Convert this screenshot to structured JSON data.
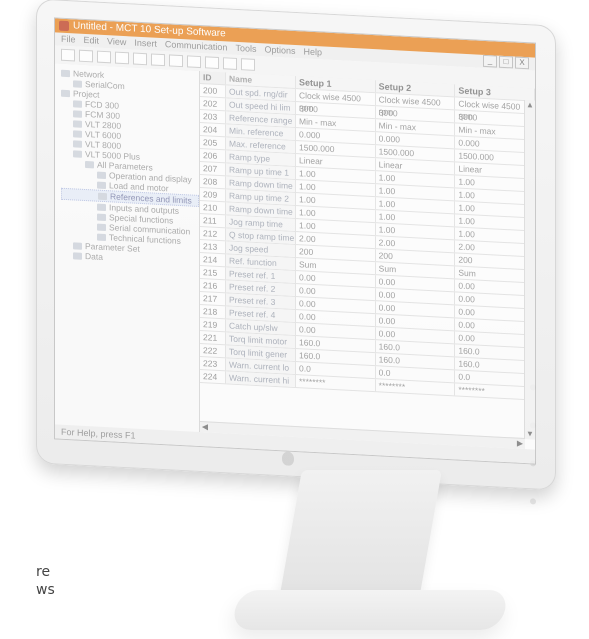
{
  "background": {
    "fragment_1": "re",
    "fragment_2": "ws"
  },
  "window": {
    "title": "Untitled - MCT 10 Set-up Software",
    "menu": [
      "File",
      "Edit",
      "View",
      "Insert",
      "Communication",
      "Tools",
      "Options",
      "Help"
    ],
    "controls": [
      "_",
      "□",
      "X"
    ],
    "status": "For Help, press F1"
  },
  "tree": {
    "items": [
      "Network",
      "SerialCom",
      "Project",
      "FCD 300",
      "FCM 300",
      "VLT 2800",
      "VLT 6000",
      "VLT 8000",
      "VLT 5000 Plus",
      "All Parameters",
      "Operation and display",
      "Load and motor",
      "References and limits",
      "Inputs and outputs",
      "Special functions",
      "Serial communication",
      "Technical functions",
      "Parameter Set",
      "Data"
    ],
    "selected_index": 12
  },
  "grid": {
    "headers": {
      "id": "ID",
      "name": "Name",
      "setup1": "Setup 1",
      "setup2": "Setup 2",
      "setup3": "Setup 3"
    },
    "rows": [
      {
        "id": "200",
        "name": "Out spd. rng/dir",
        "s1": "Clock wise 4500 rpm",
        "s2": "Clock wise 4500 rpm",
        "s3": "Clock wise 4500 rpm"
      },
      {
        "id": "202",
        "name": "Out speed hi lim",
        "s1": "3000",
        "s2": "3000",
        "s3": "3000"
      },
      {
        "id": "203",
        "name": "Reference range",
        "s1": "Min - max",
        "s2": "Min - max",
        "s3": "Min - max"
      },
      {
        "id": "204",
        "name": "Min. reference",
        "s1": "0.000",
        "s2": "0.000",
        "s3": "0.000"
      },
      {
        "id": "205",
        "name": "Max. reference",
        "s1": "1500.000",
        "s2": "1500.000",
        "s3": "1500.000"
      },
      {
        "id": "206",
        "name": "Ramp type",
        "s1": "Linear",
        "s2": "Linear",
        "s3": "Linear"
      },
      {
        "id": "207",
        "name": "Ramp up time 1",
        "s1": "1.00",
        "s2": "1.00",
        "s3": "1.00"
      },
      {
        "id": "208",
        "name": "Ramp down time 1",
        "s1": "1.00",
        "s2": "1.00",
        "s3": "1.00"
      },
      {
        "id": "209",
        "name": "Ramp up time 2",
        "s1": "1.00",
        "s2": "1.00",
        "s3": "1.00"
      },
      {
        "id": "210",
        "name": "Ramp down time 2",
        "s1": "1.00",
        "s2": "1.00",
        "s3": "1.00"
      },
      {
        "id": "211",
        "name": "Jog ramp time",
        "s1": "1.00",
        "s2": "1.00",
        "s3": "1.00"
      },
      {
        "id": "212",
        "name": "Q stop ramp time",
        "s1": "2.00",
        "s2": "2.00",
        "s3": "2.00"
      },
      {
        "id": "213",
        "name": "Jog speed",
        "s1": "200",
        "s2": "200",
        "s3": "200"
      },
      {
        "id": "214",
        "name": "Ref. function",
        "s1": "Sum",
        "s2": "Sum",
        "s3": "Sum"
      },
      {
        "id": "215",
        "name": "Preset ref. 1",
        "s1": "0.00",
        "s2": "0.00",
        "s3": "0.00"
      },
      {
        "id": "216",
        "name": "Preset ref. 2",
        "s1": "0.00",
        "s2": "0.00",
        "s3": "0.00"
      },
      {
        "id": "217",
        "name": "Preset ref. 3",
        "s1": "0.00",
        "s2": "0.00",
        "s3": "0.00"
      },
      {
        "id": "218",
        "name": "Preset ref. 4",
        "s1": "0.00",
        "s2": "0.00",
        "s3": "0.00"
      },
      {
        "id": "219",
        "name": "Catch up/slw dwn",
        "s1": "0.00",
        "s2": "0.00",
        "s3": "0.00"
      },
      {
        "id": "221",
        "name": "Torq limit motor",
        "s1": "160.0",
        "s2": "160.0",
        "s3": "160.0"
      },
      {
        "id": "222",
        "name": "Torq limit gener",
        "s1": "160.0",
        "s2": "160.0",
        "s3": "160.0"
      },
      {
        "id": "223",
        "name": "Warn. current lo",
        "s1": "0.0",
        "s2": "0.0",
        "s3": "0.0"
      },
      {
        "id": "224",
        "name": "Warn. current hi",
        "s1": "********",
        "s2": "********",
        "s3": "********"
      }
    ]
  }
}
